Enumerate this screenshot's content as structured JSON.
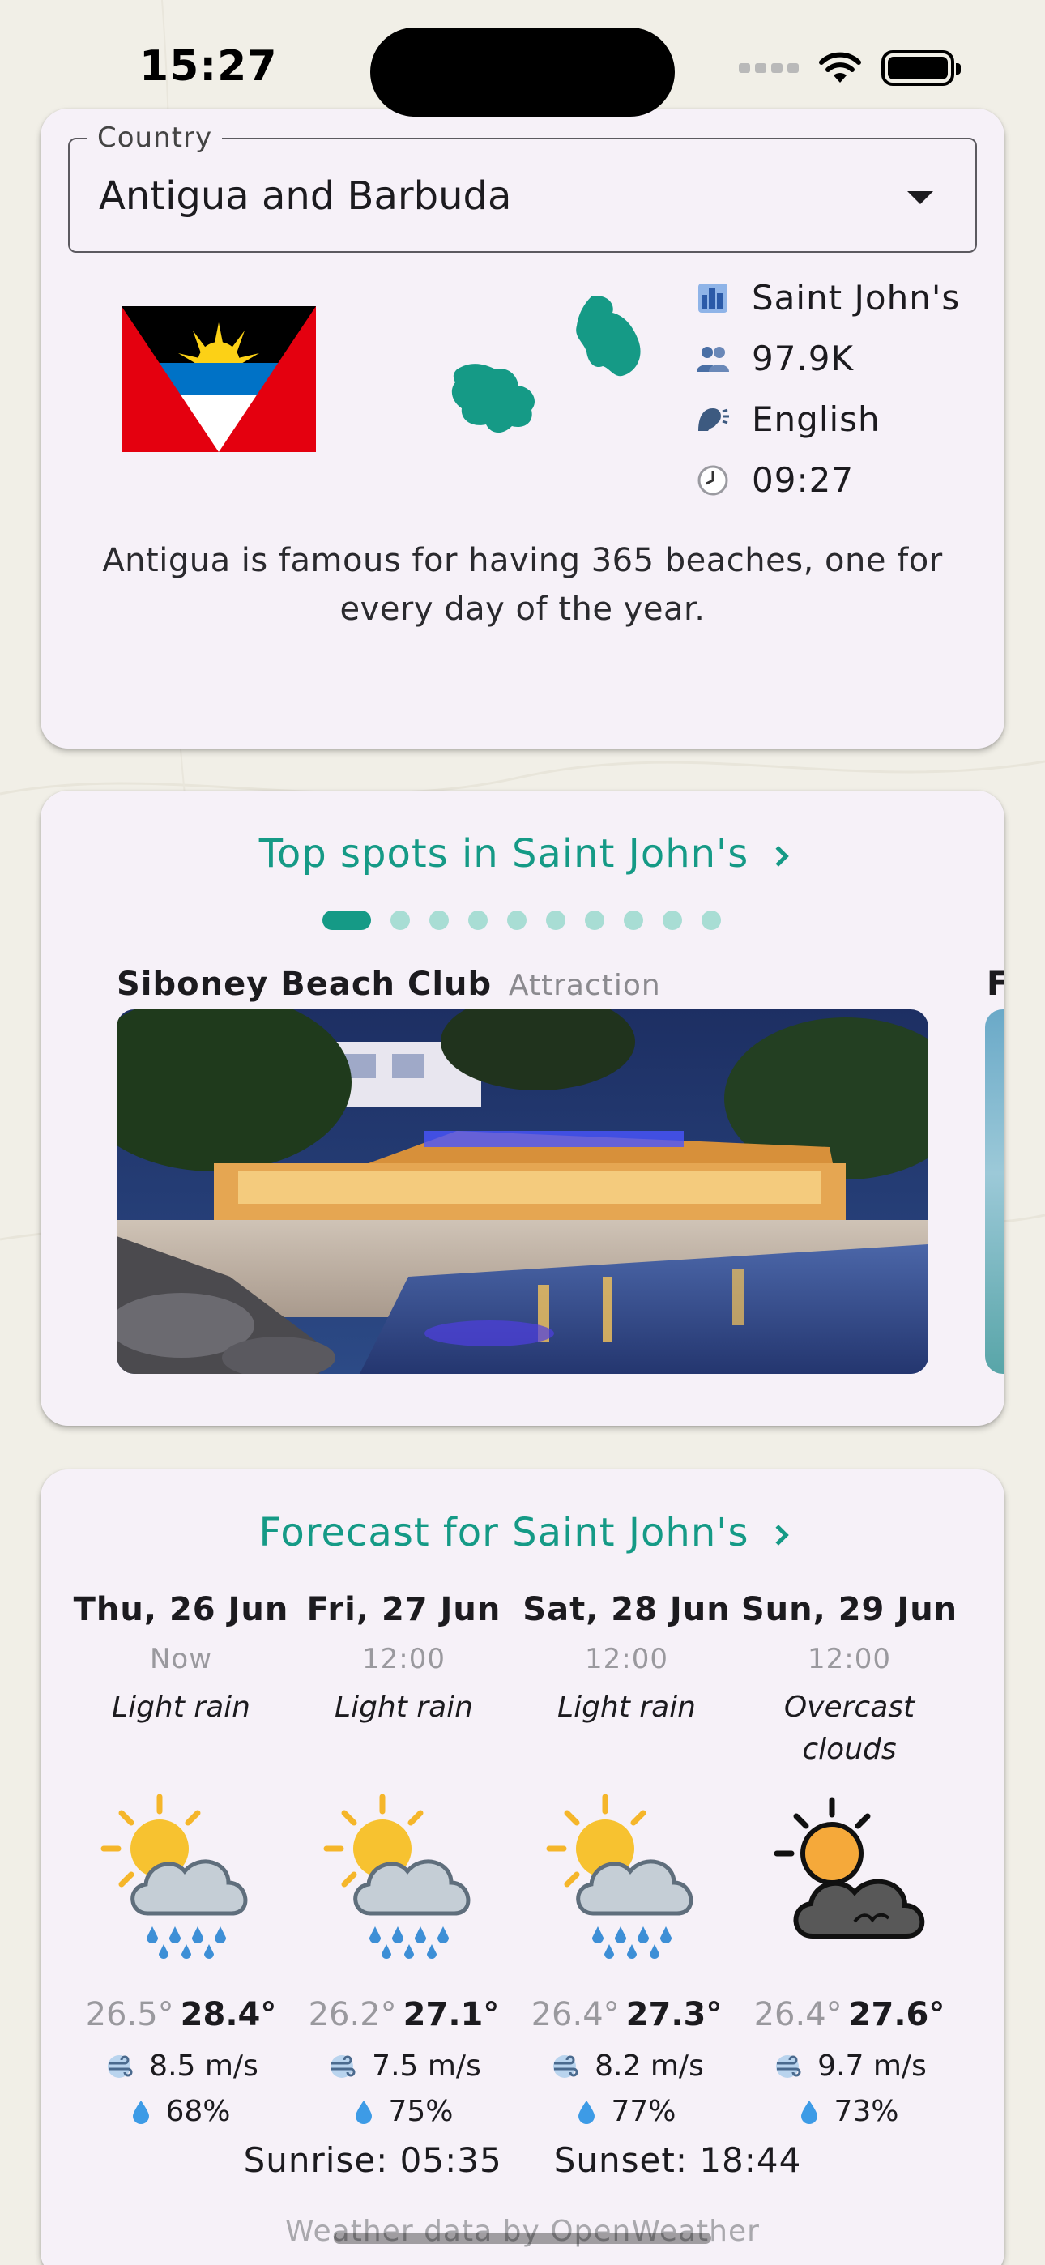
{
  "status_bar": {
    "time": "15:27"
  },
  "country_card": {
    "select_label": "Country",
    "selected_country": "Antigua and Barbuda",
    "facts": [
      {
        "icon": "city-icon",
        "text": "Saint John's"
      },
      {
        "icon": "population-icon",
        "text": "97.9K"
      },
      {
        "icon": "language-icon",
        "text": "English"
      },
      {
        "icon": "clock-icon",
        "text": "09:27"
      }
    ],
    "fun_fact": "Antigua is famous for having 365 beaches, one for every day of the year."
  },
  "spots_card": {
    "title": "Top spots in Saint John's",
    "page_count": 10,
    "active_page": 0,
    "current_spot": {
      "name": "Siboney Beach Club",
      "type": "Attraction"
    },
    "next_spot_initial": "F"
  },
  "forecast_card": {
    "title": "Forecast for Saint John's",
    "days": [
      {
        "date": "Thu, 26 Jun",
        "time": "Now",
        "condition": "Light rain",
        "icon": "sun-rain-icon",
        "min": "26.5°",
        "max": "28.4°",
        "wind": "8.5 m/s",
        "humidity": "68%"
      },
      {
        "date": "Fri, 27 Jun",
        "time": "12:00",
        "condition": "Light rain",
        "icon": "sun-rain-icon",
        "min": "26.2°",
        "max": "27.1°",
        "wind": "7.5 m/s",
        "humidity": "75%"
      },
      {
        "date": "Sat, 28 Jun",
        "time": "12:00",
        "condition": "Light rain",
        "icon": "sun-rain-icon",
        "min": "26.4°",
        "max": "27.3°",
        "wind": "8.2 m/s",
        "humidity": "77%"
      },
      {
        "date": "Sun, 29 Jun",
        "time": "12:00",
        "condition": "Overcast clouds",
        "icon": "sun-clouds-icon",
        "min": "26.4°",
        "max": "27.6°",
        "wind": "9.7 m/s",
        "humidity": "73%"
      }
    ],
    "sunrise": "Sunrise: 05:35",
    "sunset": "Sunset: 18:44",
    "attribution": "Weather data by OpenWeather"
  },
  "colors": {
    "accent": "#159a86",
    "card": "#f6f1f8",
    "background": "#f1efe7"
  }
}
